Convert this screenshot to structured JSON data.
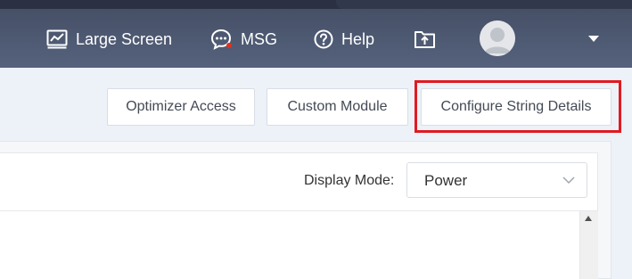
{
  "header": {
    "nav": [
      {
        "label": "Large Screen",
        "icon": "chart-icon"
      },
      {
        "label": "MSG",
        "icon": "message-icon"
      },
      {
        "label": "Help",
        "icon": "help-icon"
      }
    ],
    "upload_icon": "upload-icon",
    "avatar_icon": "user-avatar-icon",
    "menu_icon": "caret-down-icon"
  },
  "toolbar": {
    "optimizer_access": "Optimizer Access",
    "custom_module": "Custom Module",
    "configure_string_details": "Configure String Details",
    "highlight_color": "#e01a22"
  },
  "panel": {
    "display_mode_label": "Display Mode:",
    "display_mode_value": "Power"
  }
}
